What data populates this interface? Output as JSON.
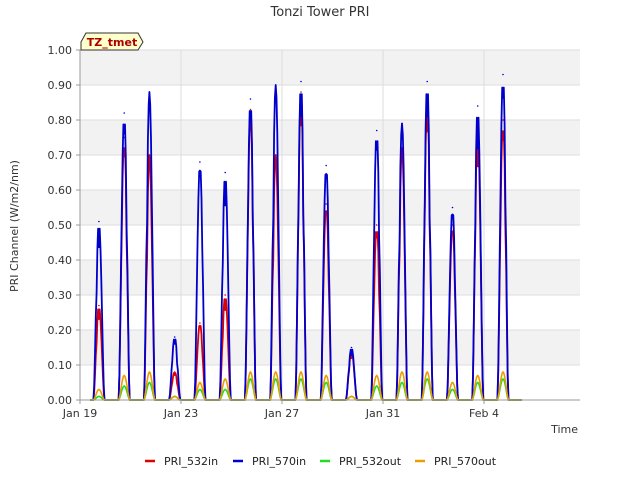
{
  "chart_data": {
    "type": "line",
    "title": "Tonzi Tower PRI",
    "xlabel": "Time",
    "ylabel": "PRI Channel (W/m2/nm)",
    "site_badge": "TZ_tmet",
    "ylim": [
      0.0,
      1.0
    ],
    "xlim": [
      0,
      19.8
    ],
    "y_ticks": [
      "0.00",
      "0.10",
      "0.20",
      "0.30",
      "0.40",
      "0.50",
      "0.60",
      "0.70",
      "0.80",
      "0.90",
      "1.00"
    ],
    "x_ticks": [
      {
        "label": "Jan 19",
        "day": 0
      },
      {
        "label": "Jan 23",
        "day": 4
      },
      {
        "label": "Jan 27",
        "day": 8
      },
      {
        "label": "Jan 31",
        "day": 12
      },
      {
        "label": "Feb 4",
        "day": 16
      }
    ],
    "grid": true,
    "legend_position": "bottom",
    "x_unit": "days since Jan 19",
    "series": [
      {
        "name": "PRI_532in",
        "color": "#dd0000",
        "peaks": [
          0.27,
          0.75,
          0.7,
          0.08,
          0.22,
          0.3,
          0.83,
          0.7,
          0.88,
          0.56,
          0.14,
          0.5,
          0.72,
          0.86,
          0.5,
          0.78,
          0.8
        ]
      },
      {
        "name": "PRI_570in",
        "color": "#0000cc",
        "peaks": [
          0.51,
          0.82,
          0.88,
          0.18,
          0.68,
          0.65,
          0.86,
          0.9,
          0.91,
          0.67,
          0.15,
          0.77,
          0.79,
          0.91,
          0.55,
          0.84,
          0.93
        ]
      },
      {
        "name": "PRI_532out",
        "color": "#22dd22",
        "peaks": [
          0.01,
          0.04,
          0.05,
          0.01,
          0.03,
          0.03,
          0.06,
          0.06,
          0.06,
          0.05,
          0.01,
          0.04,
          0.05,
          0.06,
          0.03,
          0.05,
          0.06
        ]
      },
      {
        "name": "PRI_570out",
        "color": "#e8a000",
        "peaks": [
          0.03,
          0.07,
          0.08,
          0.01,
          0.05,
          0.06,
          0.08,
          0.08,
          0.08,
          0.07,
          0.01,
          0.07,
          0.08,
          0.08,
          0.05,
          0.07,
          0.08
        ]
      }
    ],
    "peak_days": [
      0.75,
      1.75,
      2.75,
      3.75,
      4.75,
      5.75,
      6.75,
      7.75,
      8.75,
      9.75,
      10.75,
      11.75,
      12.75,
      13.75,
      14.75,
      15.75,
      16.75
    ]
  }
}
